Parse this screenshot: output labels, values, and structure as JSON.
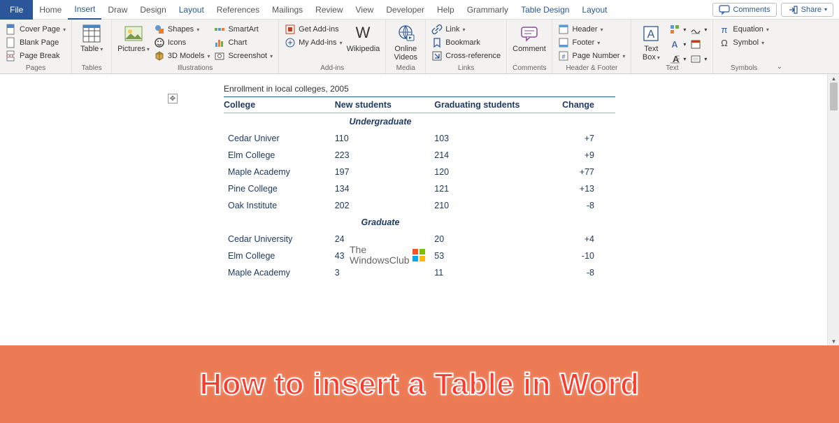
{
  "tabs": {
    "file": "File",
    "items": [
      "Home",
      "Insert",
      "Draw",
      "Design",
      "Layout",
      "References",
      "Mailings",
      "Review",
      "View",
      "Developer",
      "Help",
      "Grammarly",
      "Table Design",
      "Layout"
    ],
    "active": "Insert",
    "context": [
      "Table Design",
      "Layout"
    ],
    "comments": "Comments",
    "share": "Share"
  },
  "ribbon": {
    "pages": {
      "label": "Pages",
      "cover": "Cover Page",
      "blank": "Blank Page",
      "break": "Page Break"
    },
    "tables": {
      "label": "Tables",
      "table": "Table"
    },
    "illus": {
      "label": "Illustrations",
      "pictures": "Pictures",
      "shapes": "Shapes",
      "icons": "Icons",
      "models": "3D Models",
      "smartart": "SmartArt",
      "chart": "Chart",
      "screenshot": "Screenshot"
    },
    "addins": {
      "label": "Add-ins",
      "get": "Get Add-ins",
      "my": "My Add-ins",
      "wiki": "Wikipedia"
    },
    "media": {
      "label": "Media",
      "video": "Online\nVideos"
    },
    "links": {
      "label": "Links",
      "link": "Link",
      "bookmark": "Bookmark",
      "xref": "Cross-reference"
    },
    "comments": {
      "label": "Comments",
      "comment": "Comment"
    },
    "hf": {
      "label": "Header & Footer",
      "header": "Header",
      "footer": "Footer",
      "pagenum": "Page Number"
    },
    "text": {
      "label": "Text",
      "textbox": "Text\nBox"
    },
    "symbols": {
      "label": "Symbols",
      "equation": "Equation",
      "symbol": "Symbol"
    }
  },
  "doc": {
    "title": "Enrollment in local colleges, 2005",
    "headers": [
      "College",
      "New students",
      "Graduating students",
      "Change"
    ],
    "sections": [
      {
        "name": "Undergraduate",
        "rows": [
          {
            "college": "Cedar Univer",
            "new": "110",
            "grad": "103",
            "chg": "+7",
            "err": true
          },
          {
            "college": "Elm College",
            "new": "223",
            "grad": "214",
            "chg": "+9"
          },
          {
            "college": "Maple Academy",
            "new": "197",
            "grad": "120",
            "chg": "+77"
          },
          {
            "college": "Pine College",
            "new": "134",
            "grad": "121",
            "chg": "+13"
          },
          {
            "college": "Oak Institute",
            "new": "202",
            "grad": "210",
            "chg": "-8"
          }
        ]
      },
      {
        "name": "Graduate",
        "rows": [
          {
            "college": "Cedar University",
            "new": "24",
            "grad": "20",
            "chg": "+4"
          },
          {
            "college": "Elm College",
            "new": "43",
            "grad": "53",
            "chg": "-10"
          },
          {
            "college": "Maple Academy",
            "new": "3",
            "grad": "11",
            "chg": "-8"
          }
        ]
      }
    ]
  },
  "watermark": {
    "line1": "The",
    "line2": "WindowsClub"
  },
  "banner": "How to insert a Table in Word"
}
